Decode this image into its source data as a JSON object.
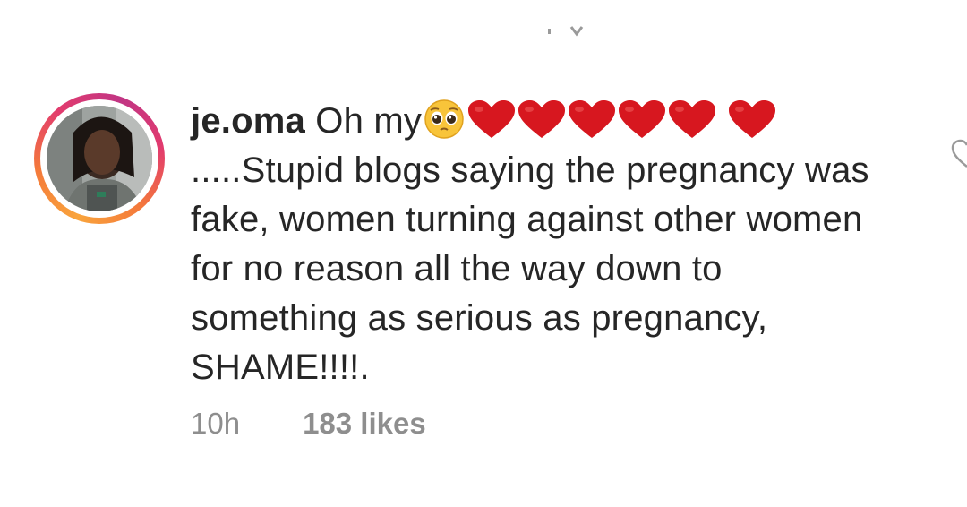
{
  "comment": {
    "username": "je.oma",
    "text_start": "Oh my",
    "text_rest": ".....Stupid blogs saying the pregnancy was fake, women turning against other women for no reason all the way down to something as serious as pregnancy, SHAME!!!!.",
    "emojis": [
      "pleading-face-emoji",
      "red-heart-emoji",
      "red-heart-emoji",
      "red-heart-emoji",
      "red-heart-emoji",
      "red-heart-emoji",
      "red-heart-emoji"
    ],
    "time": "10h",
    "likes": "183 likes"
  },
  "colors": {
    "text": "#262626",
    "meta": "#8e8e8e",
    "heart": "#d7171f",
    "ring_start": "#f9a43c",
    "ring_end": "#c13584"
  }
}
